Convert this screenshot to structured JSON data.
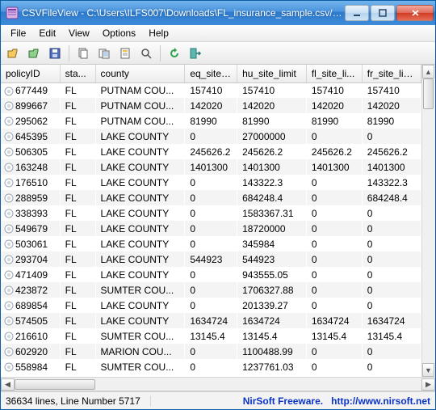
{
  "window": {
    "title": "CSVFileView  -  C:\\Users\\ILFS007\\Downloads\\FL_insurance_sample.csv/FL_ins..."
  },
  "menu": {
    "file": "File",
    "edit": "Edit",
    "view": "View",
    "options": "Options",
    "help": "Help"
  },
  "toolbar": {
    "open": "open",
    "open2": "open-advanced",
    "save": "save",
    "copy": "copy",
    "copy_items": "copy-items",
    "properties": "properties",
    "find": "find",
    "refresh": "refresh",
    "exit": "exit"
  },
  "columns": {
    "policyID": "policyID",
    "state": "sta...",
    "county": "county",
    "eq": "eq_site_l...",
    "hu": "hu_site_limit",
    "fl": "fl_site_li...",
    "fr": "fr_site_limit"
  },
  "rows": [
    {
      "policyID": "677449",
      "state": "FL",
      "county": "PUTNAM COU...",
      "eq": "157410",
      "hu": "157410",
      "fl": "157410",
      "fr": "157410"
    },
    {
      "policyID": "899667",
      "state": "FL",
      "county": "PUTNAM COU...",
      "eq": "142020",
      "hu": "142020",
      "fl": "142020",
      "fr": "142020"
    },
    {
      "policyID": "295062",
      "state": "FL",
      "county": "PUTNAM COU...",
      "eq": "81990",
      "hu": "81990",
      "fl": "81990",
      "fr": "81990"
    },
    {
      "policyID": "645395",
      "state": "FL",
      "county": "LAKE COUNTY",
      "eq": "0",
      "hu": "27000000",
      "fl": "0",
      "fr": "0"
    },
    {
      "policyID": "506305",
      "state": "FL",
      "county": "LAKE COUNTY",
      "eq": "245626.2",
      "hu": "245626.2",
      "fl": "245626.2",
      "fr": "245626.2"
    },
    {
      "policyID": "163248",
      "state": "FL",
      "county": "LAKE COUNTY",
      "eq": "1401300",
      "hu": "1401300",
      "fl": "1401300",
      "fr": "1401300"
    },
    {
      "policyID": "176510",
      "state": "FL",
      "county": "LAKE COUNTY",
      "eq": "0",
      "hu": "143322.3",
      "fl": "0",
      "fr": "143322.3"
    },
    {
      "policyID": "288959",
      "state": "FL",
      "county": "LAKE COUNTY",
      "eq": "0",
      "hu": "684248.4",
      "fl": "0",
      "fr": "684248.4"
    },
    {
      "policyID": "338393",
      "state": "FL",
      "county": "LAKE COUNTY",
      "eq": "0",
      "hu": "1583367.31",
      "fl": "0",
      "fr": "0"
    },
    {
      "policyID": "549679",
      "state": "FL",
      "county": "LAKE COUNTY",
      "eq": "0",
      "hu": "18720000",
      "fl": "0",
      "fr": "0"
    },
    {
      "policyID": "503061",
      "state": "FL",
      "county": "LAKE COUNTY",
      "eq": "0",
      "hu": "345984",
      "fl": "0",
      "fr": "0"
    },
    {
      "policyID": "293704",
      "state": "FL",
      "county": "LAKE COUNTY",
      "eq": "544923",
      "hu": "544923",
      "fl": "0",
      "fr": "0"
    },
    {
      "policyID": "471409",
      "state": "FL",
      "county": "LAKE COUNTY",
      "eq": "0",
      "hu": "943555.05",
      "fl": "0",
      "fr": "0"
    },
    {
      "policyID": "423872",
      "state": "FL",
      "county": "SUMTER COU...",
      "eq": "0",
      "hu": "1706327.88",
      "fl": "0",
      "fr": "0"
    },
    {
      "policyID": "689854",
      "state": "FL",
      "county": "LAKE COUNTY",
      "eq": "0",
      "hu": "201339.27",
      "fl": "0",
      "fr": "0"
    },
    {
      "policyID": "574505",
      "state": "FL",
      "county": "LAKE COUNTY",
      "eq": "1634724",
      "hu": "1634724",
      "fl": "1634724",
      "fr": "1634724"
    },
    {
      "policyID": "216610",
      "state": "FL",
      "county": "SUMTER COU...",
      "eq": "13145.4",
      "hu": "13145.4",
      "fl": "13145.4",
      "fr": "13145.4"
    },
    {
      "policyID": "602920",
      "state": "FL",
      "county": "MARION COU...",
      "eq": "0",
      "hu": "1100488.99",
      "fl": "0",
      "fr": "0"
    },
    {
      "policyID": "558984",
      "state": "FL",
      "county": "SUMTER COU...",
      "eq": "0",
      "hu": "1237761.03",
      "fl": "0",
      "fr": "0"
    }
  ],
  "status": {
    "left": "36634 lines, Line Number 5717",
    "right_label": "NirSoft Freeware.",
    "right_url": "http://www.nirsoft.net"
  }
}
